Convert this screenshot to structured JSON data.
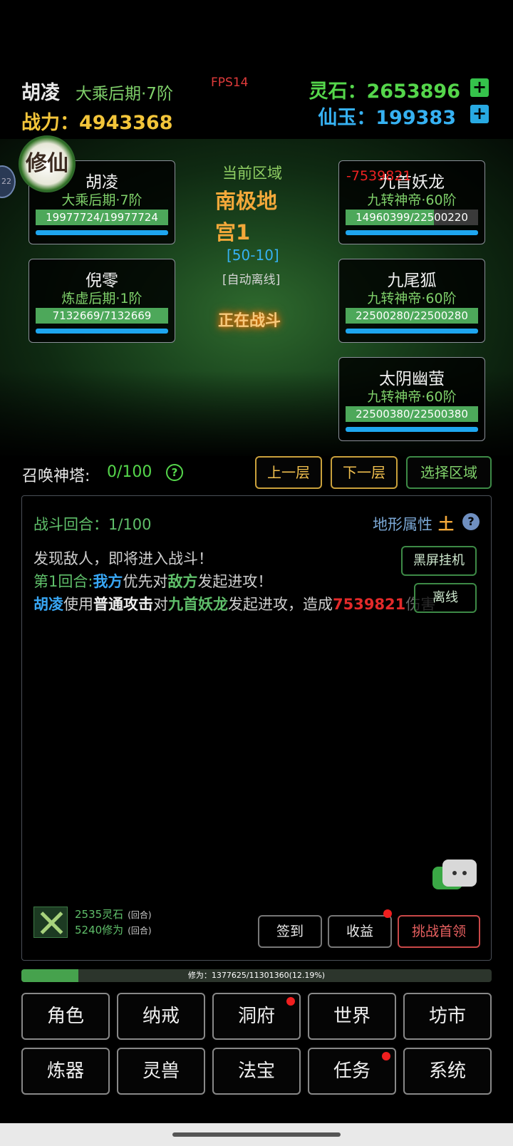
{
  "header": {
    "player_name": "胡凌",
    "realm": "大乘后期·7阶",
    "fps": "FPS14",
    "power_label": "战力：",
    "power_value": "4943368",
    "spirit_stone_label": "灵石：",
    "spirit_stone_value": "2653896",
    "jade_label": "仙玉：",
    "jade_value": "199383",
    "plus": "+"
  },
  "logo": {
    "text": "修仙"
  },
  "side_badge": "22",
  "team": [
    {
      "name": "胡凌",
      "rank": "大乘后期·7阶",
      "hp_text": "19977724/19977724",
      "hp_fraction": 1.0
    },
    {
      "name": "倪零",
      "rank": "炼虚后期·1阶",
      "hp_text": "7132669/7132669",
      "hp_fraction": 1.0
    }
  ],
  "enemies": [
    {
      "name": "九首妖龙",
      "rank": "九转神帝·60阶",
      "hp_text": "14960399/22500220",
      "hp_fraction": 0.665
    },
    {
      "name": "九尾狐",
      "rank": "九转神帝·60阶",
      "hp_text": "22500280/22500280",
      "hp_fraction": 1.0
    },
    {
      "name": "太阴幽萤",
      "rank": "九转神帝·60阶",
      "hp_text": "22500380/22500380",
      "hp_fraction": 1.0
    }
  ],
  "damage_float": "-7539821",
  "zone": {
    "label": "当前区域",
    "name": "南极地宫1",
    "range": "[50-10]",
    "auto": "[自动离线]",
    "status": "正在战斗"
  },
  "tower": {
    "label": "召唤神塔:",
    "value": "0/100",
    "help": "?",
    "prev_btn": "上一层",
    "next_btn": "下一层",
    "select_btn": "选择区域"
  },
  "battle": {
    "round_label": "战斗回合：1/100",
    "terrain_label": "地形属性",
    "terrain_value": "土",
    "terrain_help": "?",
    "afk_btn": "黑屏挂机",
    "offline_btn": "离线",
    "log": {
      "line1": "发现敌人，即将进入战斗！",
      "l2_round": "第1回合:",
      "l2_us": "我方",
      "l2_mid": "优先对",
      "l2_enemy": "敌方",
      "l2_end": "发起进攻！",
      "l3_actor": "胡凌",
      "l3_a": "使用",
      "l3_skill": "普通攻击",
      "l3_b": "对",
      "l3_target": "九首妖龙",
      "l3_c": "发起进攻，造成",
      "l3_dmg": "7539821",
      "l3_d": "伤害"
    },
    "reward_stone": "2535灵石",
    "reward_cult": "5240修为",
    "per_round": "(回合)",
    "signin_btn": "签到",
    "income_btn": "收益",
    "boss_btn": "挑战首领"
  },
  "xp": {
    "text": "修为：1377625/11301360(12.19%)",
    "fraction": 0.1219
  },
  "menu": [
    "角色",
    "纳戒",
    "洞府",
    "世界",
    "坊市",
    "炼器",
    "灵兽",
    "法宝",
    "任务",
    "系统"
  ],
  "colors": {
    "green": "#55d64b",
    "blue": "#36b1f2",
    "gold": "#f3c53a",
    "orange": "#f3a83a",
    "red": "#e32a2a"
  }
}
